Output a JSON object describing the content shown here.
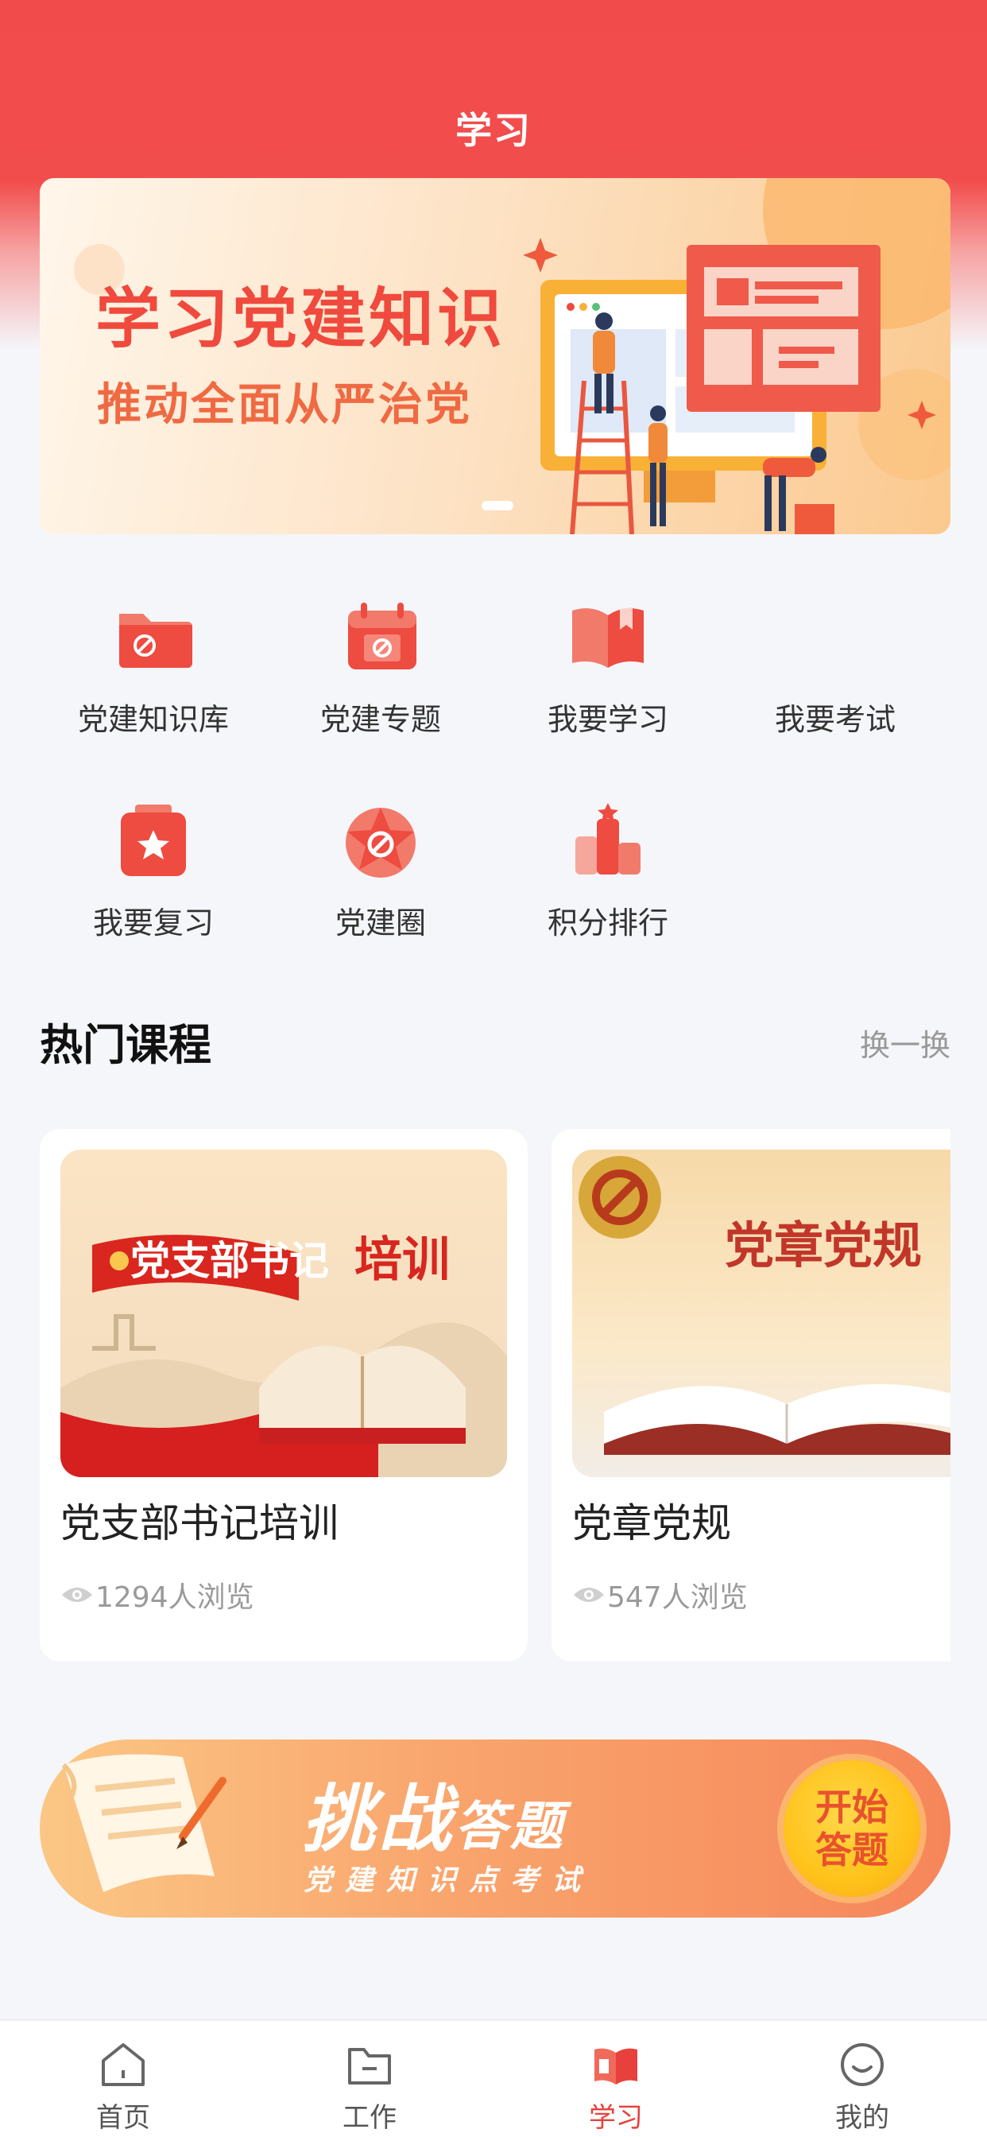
{
  "header": {
    "title": "学习"
  },
  "banner": {
    "title": "学习党建知识",
    "subtitle": "推动全面从严治党",
    "slide_index": 1,
    "slide_count": 1
  },
  "quick_grid": [
    {
      "label": "党建知识库",
      "icon": "folder-party-icon"
    },
    {
      "label": "党建专题",
      "icon": "calendar-party-icon"
    },
    {
      "label": "我要学习",
      "icon": "book-icon"
    },
    {
      "label": "我要考试",
      "icon": "exam-icon"
    },
    {
      "label": "我要复习",
      "icon": "star-box-icon"
    },
    {
      "label": "党建圈",
      "icon": "party-emblem-icon"
    },
    {
      "label": "积分排行",
      "icon": "ranking-icon"
    }
  ],
  "hot_courses": {
    "title": "热门课程",
    "refresh_label": "换一换",
    "items": [
      {
        "title": "党支部书记培训",
        "views": "1294人浏览",
        "cover_text_a": "党支部书记",
        "cover_text_b": "培训"
      },
      {
        "title": "党章党规",
        "views": "547人浏览",
        "cover_text_a": "党章党规"
      }
    ]
  },
  "challenge": {
    "title_a": "挑战",
    "title_b": "答题",
    "subtitle": "党建知识点考试",
    "button_line1": "开始",
    "button_line2": "答题"
  },
  "tabbar": {
    "active": 2,
    "items": [
      {
        "label": "首页",
        "icon": "home-icon"
      },
      {
        "label": "工作",
        "icon": "folder-icon"
      },
      {
        "label": "学习",
        "icon": "study-book-icon"
      },
      {
        "label": "我的",
        "icon": "smile-icon"
      }
    ]
  },
  "colors": {
    "primary": "#f24b4b",
    "accent": "#e8403c",
    "page_bg": "#f5f6fa"
  }
}
